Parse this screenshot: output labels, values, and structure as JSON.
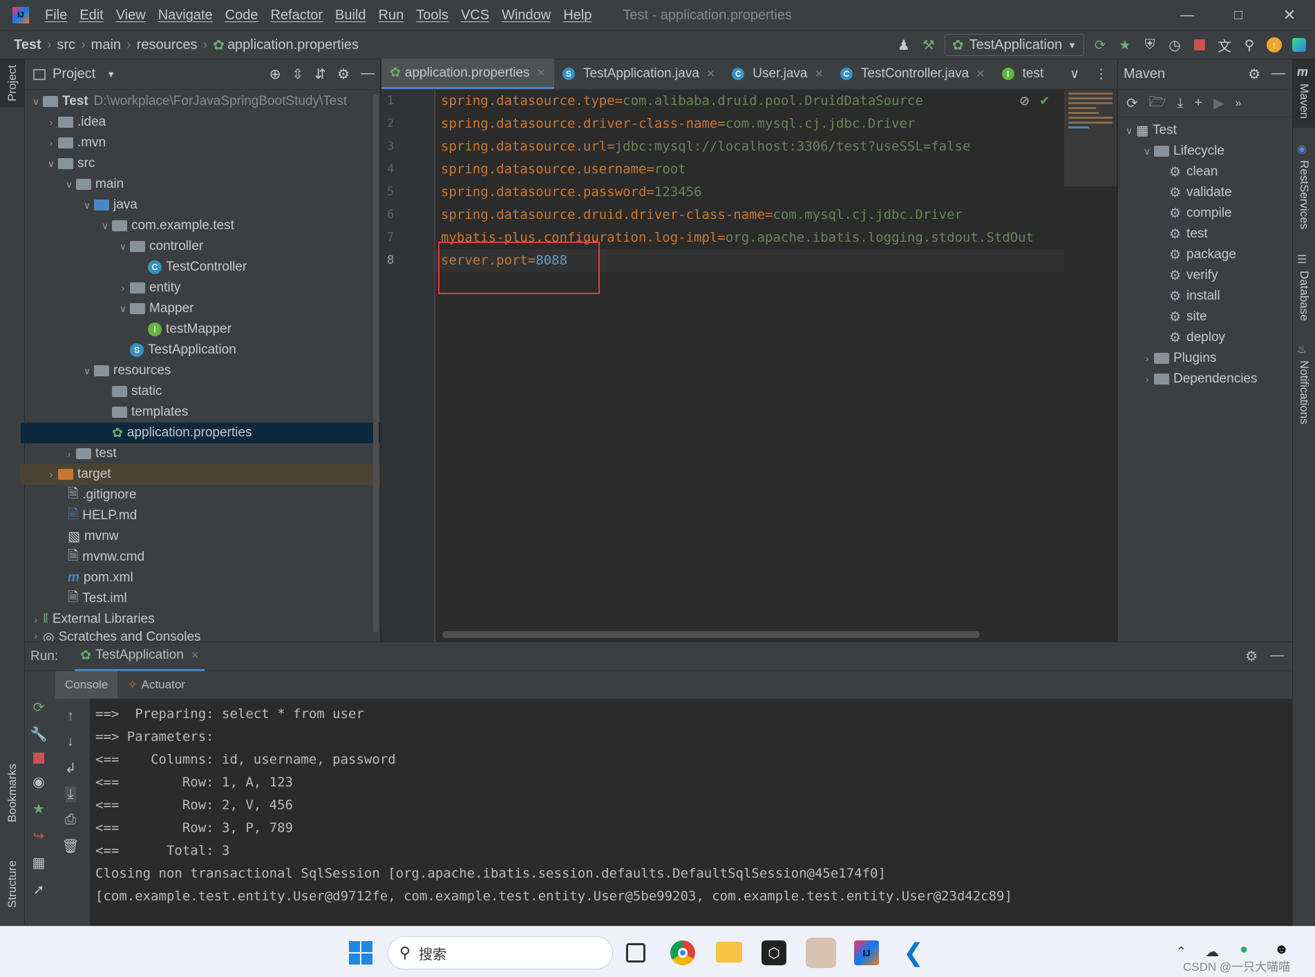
{
  "window": {
    "title": "Test - application.properties"
  },
  "menu": [
    "File",
    "Edit",
    "View",
    "Navigate",
    "Code",
    "Refactor",
    "Build",
    "Run",
    "Tools",
    "VCS",
    "Window",
    "Help"
  ],
  "breadcrumb": [
    "Test",
    "src",
    "main",
    "resources",
    "application.properties"
  ],
  "run_config": "TestApplication",
  "project": {
    "header": "Project",
    "root_name": "Test",
    "root_path": "D:\\workplace\\ForJavaSpringBootStudy\\Test",
    "items": [
      ".idea",
      ".mvn",
      "src",
      "main",
      "java",
      "com.example.test",
      "controller",
      "TestController",
      "entity",
      "Mapper",
      "testMapper",
      "TestApplication",
      "resources",
      "static",
      "templates",
      "application.properties",
      "test",
      "target",
      ".gitignore",
      "HELP.md",
      "mvnw",
      "mvnw.cmd",
      "pom.xml",
      "Test.iml",
      "External Libraries",
      "Scratches and Consoles"
    ]
  },
  "tabs": [
    "application.properties",
    "TestApplication.java",
    "User.java",
    "TestController.java",
    "test"
  ],
  "code": [
    {
      "key": "spring.datasource.type",
      "value": "com.alibaba.druid.pool.DruidDataSource"
    },
    {
      "key": "spring.datasource.driver-class-name",
      "value": "com.mysql.cj.jdbc.Driver"
    },
    {
      "key": "spring.datasource.url",
      "value": "jdbc:mysql://localhost:3306/test?useSSL=false"
    },
    {
      "key": "spring.datasource.username",
      "value": "root"
    },
    {
      "key": "spring.datasource.password",
      "value": "123456"
    },
    {
      "key": "spring.datasource.druid.driver-class-name",
      "value": "com.mysql.cj.jdbc.Driver"
    },
    {
      "key": "mybatis-plus.configuration.log-impl",
      "value": "org.apache.ibatis.logging.stdout.StdOut"
    },
    {
      "key": "server.port",
      "value": "8088"
    }
  ],
  "line_numbers": [
    "1",
    "2",
    "3",
    "4",
    "5",
    "6",
    "7",
    "8"
  ],
  "maven": {
    "header": "Maven",
    "root": "Test",
    "lifecycle": "Lifecycle",
    "goals": [
      "clean",
      "validate",
      "compile",
      "test",
      "package",
      "verify",
      "install",
      "site",
      "deploy"
    ],
    "plugins": "Plugins",
    "dependencies": "Dependencies"
  },
  "right_strip": [
    "Maven",
    "RestServices",
    "Database",
    "Notifications"
  ],
  "left_strip": [
    "Project",
    "Bookmarks",
    "Structure"
  ],
  "run": {
    "label": "Run:",
    "tab": "TestApplication",
    "subtabs": [
      "Console",
      "Actuator"
    ],
    "console": [
      "==>  Preparing: select * from user",
      "==> Parameters: ",
      "<==    Columns: id, username, password",
      "<==        Row: 1, A, 123",
      "<==        Row: 2, V, 456",
      "<==        Row: 3, P, 789",
      "<==      Total: 3",
      "Closing non transactional SqlSession [org.apache.ibatis.session.defaults.DefaultSqlSession@45e174f0]",
      "[com.example.test.entity.User@d9712fe, com.example.test.entity.User@5be99203, com.example.test.entity.User@23d42c89]"
    ]
  },
  "taskbar": {
    "search_placeholder": "搜索",
    "watermark": "CSDN @一只大喵喵"
  },
  "colors": {
    "accent": "#4a88c7",
    "highlight_box": "#e03c3c",
    "selection": "#0d293e"
  }
}
